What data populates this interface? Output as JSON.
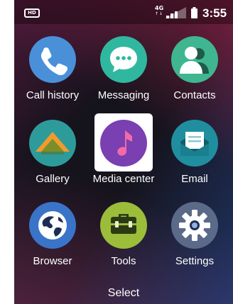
{
  "status_bar": {
    "hd_badge": "HD",
    "network": "4G",
    "network_arrows": "↑↓",
    "time": "3:55",
    "icons": [
      "hd-voice-icon",
      "signal-icon",
      "battery-icon"
    ]
  },
  "apps": [
    {
      "label": "Call history",
      "icon": "phone-icon",
      "color": "#4a90d9"
    },
    {
      "label": "Messaging",
      "icon": "chat-bubble-icon",
      "color": "#2fb89f"
    },
    {
      "label": "Contacts",
      "icon": "contacts-icon",
      "color": "#3fb68f"
    },
    {
      "label": "Gallery",
      "icon": "mountain-icon",
      "color": "#2e9b9b"
    },
    {
      "label": "Media center",
      "icon": "music-note-icon",
      "color": "#7a3fb0",
      "selected": true
    },
    {
      "label": "Email",
      "icon": "envelope-icon",
      "color": "#1f8fa0"
    },
    {
      "label": "Browser",
      "icon": "globe-icon",
      "color": "#3a74c8"
    },
    {
      "label": "Tools",
      "icon": "toolbox-icon",
      "color": "#9bbd3a"
    },
    {
      "label": "Settings",
      "icon": "gear-icon",
      "color": "#5a6a88"
    }
  ],
  "softkey": {
    "center": "Select"
  }
}
